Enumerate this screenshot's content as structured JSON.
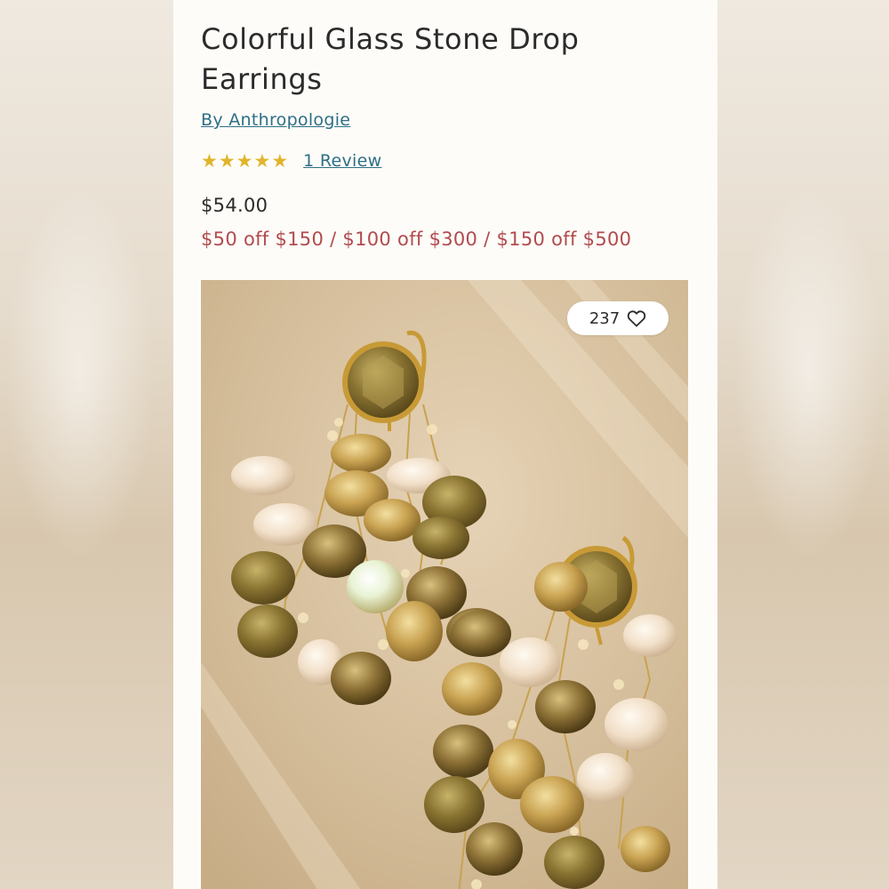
{
  "product": {
    "title": "Colorful Glass Stone Drop Earrings",
    "brand": "By Anthropologie",
    "rating_stars": 5,
    "review_link": "1 Review",
    "price": "$54.00",
    "promo": "$50 off $150 / $100 off $300 / $150 off $500"
  },
  "image": {
    "favorites_count": "237",
    "favorite_icon": "heart-outline-icon",
    "subject": "gold drop earrings with amber, olive and cream glass stones on beige background"
  },
  "colors": {
    "link": "#2e6f86",
    "promo": "#b14b4e",
    "star": "#e0b52c",
    "text": "#2b2b2b"
  }
}
